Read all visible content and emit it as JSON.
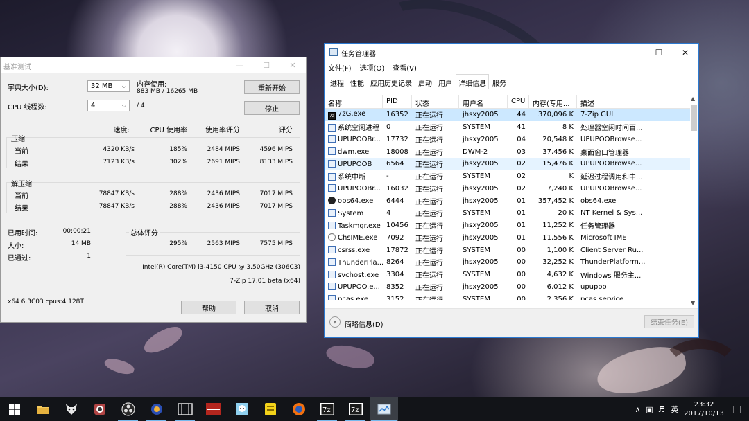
{
  "benchmark": {
    "title": "基准测试",
    "dict_label": "字典大小(D):",
    "dict_value": "32 MB",
    "threads_label": "CPU 线程数:",
    "threads_value": "4",
    "threads_total": "/ 4",
    "mem_label": "内存使用:",
    "mem_value": "883 MB / 16265 MB",
    "restart_button": "重新开始",
    "stop_button": "停止",
    "col_headers": [
      "速度:",
      "CPU 使用率",
      "使用率评分",
      "评分"
    ],
    "compress": {
      "title": "压缩",
      "rows": [
        {
          "label": "当前",
          "speed": "4320 KB/s",
          "cpu": "185%",
          "usage_rating": "2484 MIPS",
          "rating": "4596 MIPS"
        },
        {
          "label": "结果",
          "speed": "7123 KB/s",
          "cpu": "302%",
          "usage_rating": "2691 MIPS",
          "rating": "8133 MIPS"
        }
      ]
    },
    "decompress": {
      "title": "解压缩",
      "rows": [
        {
          "label": "当前",
          "speed": "78847 KB/s",
          "cpu": "288%",
          "usage_rating": "2436 MIPS",
          "rating": "7017 MIPS"
        },
        {
          "label": "结果",
          "speed": "78847 KB/s",
          "cpu": "288%",
          "usage_rating": "2436 MIPS",
          "rating": "7017 MIPS"
        }
      ]
    },
    "elapsed_label": "已用时间:",
    "elapsed_value": "00:00:21",
    "size_label": "大小:",
    "size_value": "14 MB",
    "passes_label": "已通过:",
    "passes_value": "1",
    "total": {
      "title": "总体评分",
      "cpu": "295%",
      "usage_rating": "2563 MIPS",
      "rating": "7575 MIPS"
    },
    "cpu_info": "Intel(R) Core(TM) i3-4150 CPU @ 3.50GHz (306C3)",
    "version": "7-Zip 17.01 beta (x64)",
    "sys_info": "x64 6.3C03 cpus:4 128T",
    "help_button": "帮助",
    "cancel_button": "取消"
  },
  "taskmgr": {
    "title": "任务管理器",
    "menus": [
      "文件(F)",
      "选项(O)",
      "查看(V)"
    ],
    "tabs": [
      "进程",
      "性能",
      "应用历史记录",
      "启动",
      "用户",
      "详细信息",
      "服务"
    ],
    "active_tab": 5,
    "columns": [
      "名称",
      "PID",
      "状态",
      "用户名",
      "CPU",
      "内存(专用...",
      "描述"
    ],
    "rows": [
      {
        "icon": "7zip-icon",
        "name": "7zG.exe",
        "pid": "16352",
        "status": "正在运行",
        "user": "jhsxy2005",
        "cpu": "44",
        "mem": "370,096 K",
        "desc": "7-Zip GUI"
      },
      {
        "icon": "process-icon",
        "name": "系统空闲进程",
        "pid": "0",
        "status": "正在运行",
        "user": "SYSTEM",
        "cpu": "41",
        "mem": "8 K",
        "desc": "处理器空闲时间百..."
      },
      {
        "icon": "process-icon",
        "name": "UPUPOOBr...",
        "pid": "17732",
        "status": "正在运行",
        "user": "jhsxy2005",
        "cpu": "04",
        "mem": "20,548 K",
        "desc": "UPUPOOBrowse..."
      },
      {
        "icon": "process-icon",
        "name": "dwm.exe",
        "pid": "18008",
        "status": "正在运行",
        "user": "DWM-2",
        "cpu": "03",
        "mem": "37,456 K",
        "desc": "桌面窗口管理器"
      },
      {
        "icon": "process-icon",
        "name": "UPUPOOB",
        "pid": "6564",
        "status": "正在运行",
        "user": "jhsxy2005",
        "cpu": "02",
        "mem": "15,476 K",
        "desc": "UPUPOOBrowse..."
      },
      {
        "icon": "process-icon",
        "name": "系统中断",
        "pid": "-",
        "status": "正在运行",
        "user": "SYSTEM",
        "cpu": "02",
        "mem": "K",
        "desc": "延迟过程调用和中..."
      },
      {
        "icon": "process-icon",
        "name": "UPUPOOBr...",
        "pid": "16032",
        "status": "正在运行",
        "user": "jhsxy2005",
        "cpu": "02",
        "mem": "7,240 K",
        "desc": "UPUPOOBrowse..."
      },
      {
        "icon": "obs-icon",
        "name": "obs64.exe",
        "pid": "6444",
        "status": "正在运行",
        "user": "jhsxy2005",
        "cpu": "01",
        "mem": "357,452 K",
        "desc": "obs64.exe"
      },
      {
        "icon": "process-icon",
        "name": "System",
        "pid": "4",
        "status": "正在运行",
        "user": "SYSTEM",
        "cpu": "01",
        "mem": "20 K",
        "desc": "NT Kernel & Sys..."
      },
      {
        "icon": "process-icon",
        "name": "Taskmgr.exe",
        "pid": "10456",
        "status": "正在运行",
        "user": "jhsxy2005",
        "cpu": "01",
        "mem": "11,252 K",
        "desc": "任务管理器"
      },
      {
        "icon": "ime-icon",
        "name": "ChsIME.exe",
        "pid": "7092",
        "status": "正在运行",
        "user": "jhsxy2005",
        "cpu": "01",
        "mem": "11,556 K",
        "desc": "Microsoft IME"
      },
      {
        "icon": "process-icon",
        "name": "csrss.exe",
        "pid": "17872",
        "status": "正在运行",
        "user": "SYSTEM",
        "cpu": "00",
        "mem": "1,100 K",
        "desc": "Client Server Ru..."
      },
      {
        "icon": "process-icon",
        "name": "ThunderPla...",
        "pid": "8264",
        "status": "正在运行",
        "user": "jhsxy2005",
        "cpu": "00",
        "mem": "32,252 K",
        "desc": "ThunderPlatform..."
      },
      {
        "icon": "process-icon",
        "name": "svchost.exe",
        "pid": "3304",
        "status": "正在运行",
        "user": "SYSTEM",
        "cpu": "00",
        "mem": "4,632 K",
        "desc": "Windows 服务主..."
      },
      {
        "icon": "process-icon",
        "name": "UPUPOO.e...",
        "pid": "8352",
        "status": "正在运行",
        "user": "jhsxy2005",
        "cpu": "00",
        "mem": "6,012 K",
        "desc": "upupoo"
      },
      {
        "icon": "process-icon",
        "name": "pcas.exe",
        "pid": "3152",
        "status": "正在运行",
        "user": "SYSTEM",
        "cpu": "00",
        "mem": "2,356 K",
        "desc": "pcas service"
      }
    ],
    "less_details": "简略信息(D)",
    "end_task": "结束任务(E)"
  },
  "taskbar": {
    "ime_lang": "英",
    "time": "23:32",
    "date": "2017/10/13",
    "accent": "#76b9ed"
  }
}
